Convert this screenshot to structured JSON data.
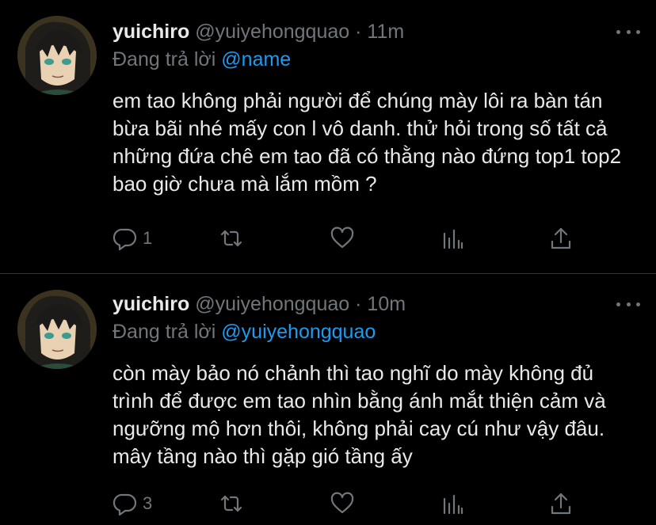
{
  "tweets": [
    {
      "name": "yuichiro",
      "handle": "@yuiyehongquao",
      "separator": "·",
      "time": "11m",
      "reply_prefix": "Đang trả lời",
      "reply_to": "@name",
      "text": "em tao không phải người để chúng mày lôi ra bàn tán bừa bãi nhé mấy con l vô danh. thử hỏi trong số tất cả những đứa chê em tao đã có thằng nào đứng top1 top2 bao giờ chưa mà lắm mồm ?",
      "reply_count": "1"
    },
    {
      "name": "yuichiro",
      "handle": "@yuiyehongquao",
      "separator": "·",
      "time": "10m",
      "reply_prefix": "Đang trả lời",
      "reply_to": "@yuiyehongquao",
      "text": "còn mày bảo nó chảnh thì tao nghĩ do mày không đủ trình để được em tao nhìn bằng ánh mắt thiện cảm và ngưỡng mộ hơn thôi, không phải cay cú như vậy đâu. mây tầng nào thì gặp gió tầng ấy",
      "reply_count": "3"
    }
  ],
  "icons": {
    "reply": "comment-bubble-icon",
    "retweet": "retweet-icon",
    "like": "heart-icon",
    "views": "bar-chart-icon",
    "share": "share-upload-icon",
    "more": "more-dots-icon"
  },
  "colors": {
    "background": "#000000",
    "text": "#e7e9ea",
    "muted": "#71767b",
    "link": "#1d9bf0",
    "divider": "#2f3336"
  }
}
